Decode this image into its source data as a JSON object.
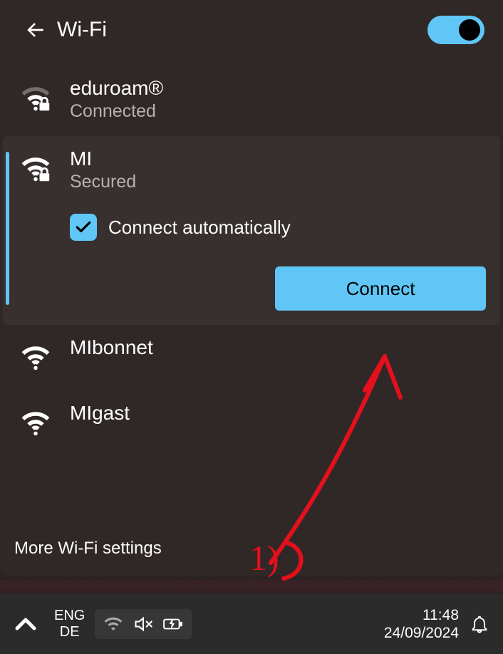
{
  "header": {
    "title": "Wi-Fi",
    "toggle_on": true
  },
  "networks": {
    "0": {
      "name": "eduroam®",
      "status": "Connected",
      "secured": true
    },
    "1": {
      "name": "MI",
      "status": "Secured",
      "secured": true,
      "expanded": true,
      "auto_label": "Connect automatically",
      "auto_checked": true,
      "connect_label": "Connect"
    },
    "2": {
      "name": "MIbonnet",
      "secured": false
    },
    "3": {
      "name": "MIgast",
      "secured": false
    }
  },
  "footer": {
    "more_label": "More Wi-Fi settings"
  },
  "taskbar": {
    "lang1": "ENG",
    "lang2": "DE",
    "time": "11:48",
    "date": "24/09/2024"
  },
  "annotation": {
    "label": "1)"
  },
  "colors": {
    "accent": "#5fc6f5"
  }
}
